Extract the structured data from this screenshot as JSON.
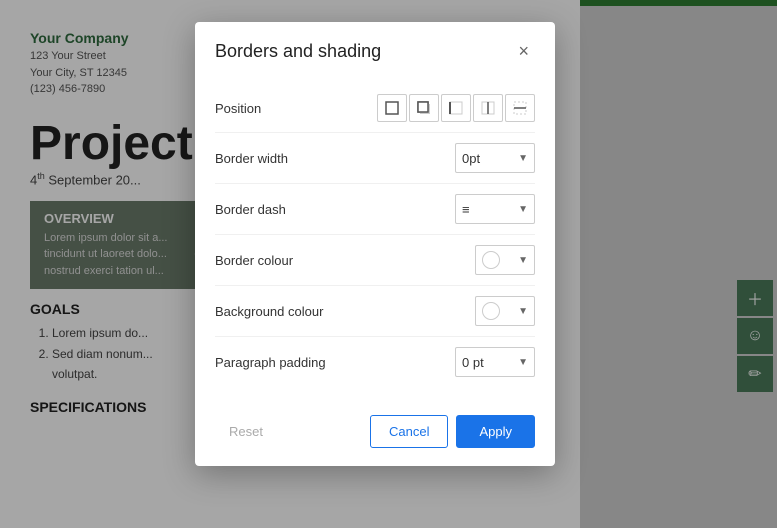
{
  "topbar": {
    "color": "#2e7d32"
  },
  "document": {
    "company_name": "Your Company",
    "address_line1": "123 Your Street",
    "address_line2": "Your City, ST 12345",
    "address_line3": "(123) 456-7890",
    "title": "Project",
    "date": "4",
    "date_suffix": "th",
    "date_text": " September 20...",
    "overview_title": "OVERVIEW",
    "overview_text": "Lorem ipsum dolor sit a...                    h euismod\ntincidunt ut laoreet dolo...                    eniam, quis\nnostrud exerci tation ul...",
    "goals_title": "GOALS",
    "goals_item1": "Lorem ipsum do...",
    "goals_item2": "Sed diam nonum...",
    "goals_item3": "volutpat.",
    "specs_title": "SPECIFICATIONS"
  },
  "sidebar_icons": [
    {
      "name": "add-comment-icon",
      "symbol": "＋"
    },
    {
      "name": "emoji-icon",
      "symbol": "☺"
    },
    {
      "name": "edit-icon",
      "symbol": "✏"
    }
  ],
  "dialog": {
    "title": "Borders and shading",
    "close_label": "×",
    "position_label": "Position",
    "position_buttons": [
      {
        "name": "border-box-icon",
        "symbol": "☐"
      },
      {
        "name": "border-shadow-icon",
        "symbol": "▣"
      },
      {
        "name": "border-left-right-icon",
        "symbol": "▤"
      },
      {
        "name": "border-top-bottom-icon",
        "symbol": "▥"
      },
      {
        "name": "border-none-icon",
        "symbol": "▦"
      }
    ],
    "border_width_label": "Border width",
    "border_width_value": "0pt",
    "border_dash_label": "Border dash",
    "border_colour_label": "Border colour",
    "background_colour_label": "Background colour",
    "paragraph_padding_label": "Paragraph padding",
    "paragraph_padding_value": "0 pt",
    "reset_label": "Reset",
    "cancel_label": "Cancel",
    "apply_label": "Apply"
  }
}
